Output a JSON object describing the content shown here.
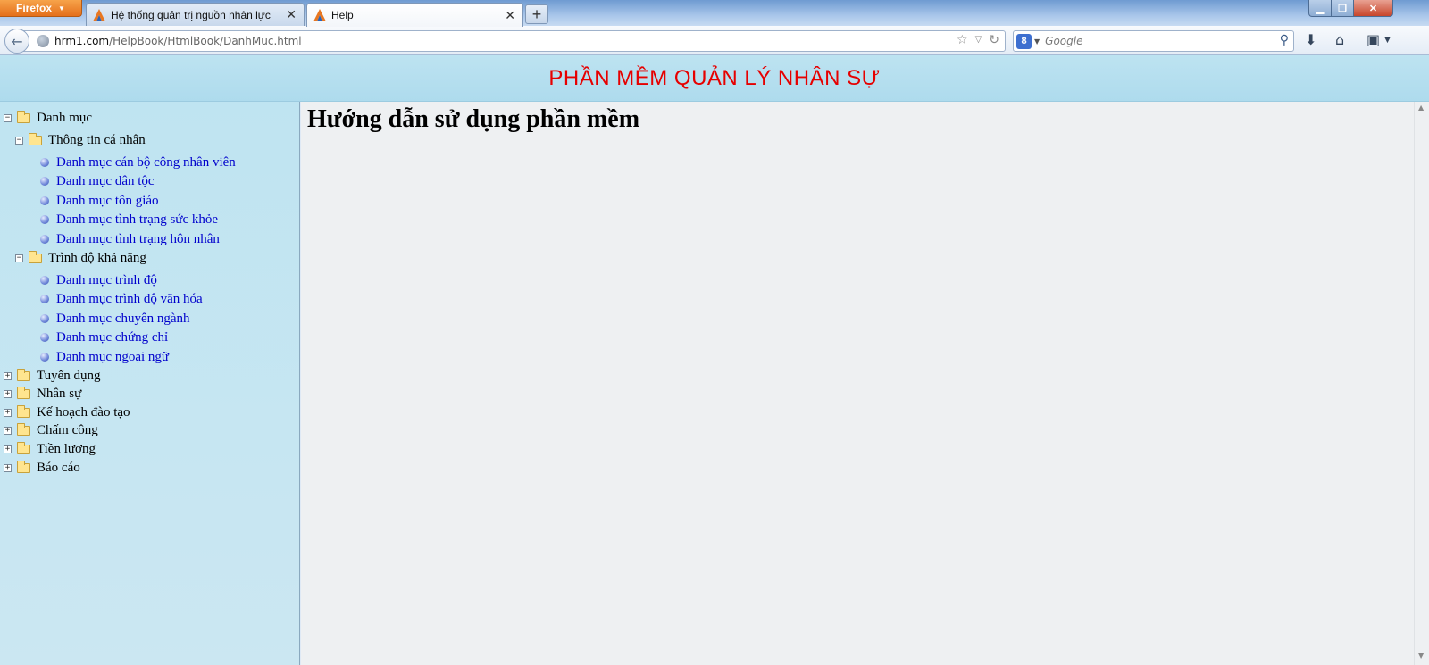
{
  "browser": {
    "menu_button": "Firefox",
    "tabs": [
      {
        "title": "Hệ thống quản trị nguồn nhân lực",
        "active": false
      },
      {
        "title": "Help",
        "active": true
      }
    ],
    "new_tab": "+",
    "url": {
      "host": "hrm1.com",
      "path": "/HelpBook/HtmlBook/DanhMuc.html"
    },
    "search_placeholder": "Google",
    "search_engine_letter": "8"
  },
  "header": {
    "title": "PHẦN MỀM QUẢN LÝ NHÂN SỰ",
    "title_color": "#e60000"
  },
  "sidebar": {
    "tree": [
      {
        "label": "Danh mục",
        "expanded": true,
        "toggle": "−"
      },
      {
        "label": "Thông tin cá nhân",
        "expanded": true,
        "toggle": "−"
      },
      {
        "label": "Danh mục cán bộ công nhân viên"
      },
      {
        "label": "Danh mục dân tộc"
      },
      {
        "label": "Danh mục tôn giáo"
      },
      {
        "label": "Danh mục tình trạng sức khỏe"
      },
      {
        "label": "Danh mục tình trạng hôn nhân"
      },
      {
        "label": "Trình độ khả năng",
        "expanded": true,
        "toggle": "−"
      },
      {
        "label": "Danh mục trình độ"
      },
      {
        "label": "Danh mục trình độ văn hóa"
      },
      {
        "label": "Danh mục chuyên ngành"
      },
      {
        "label": "Danh mục chứng chỉ"
      },
      {
        "label": "Danh mục ngoại ngữ"
      },
      {
        "label": "Tuyển dụng",
        "expanded": false,
        "toggle": "+"
      },
      {
        "label": "Nhân sự",
        "expanded": false,
        "toggle": "+"
      },
      {
        "label": "Kế hoạch đào tạo",
        "expanded": false,
        "toggle": "+"
      },
      {
        "label": "Chấm công",
        "expanded": false,
        "toggle": "+"
      },
      {
        "label": "Tiền lương",
        "expanded": false,
        "toggle": "+"
      },
      {
        "label": "Báo cáo",
        "expanded": false,
        "toggle": "+"
      }
    ]
  },
  "content": {
    "title": "Hướng dẫn sử dụng phần mềm"
  }
}
